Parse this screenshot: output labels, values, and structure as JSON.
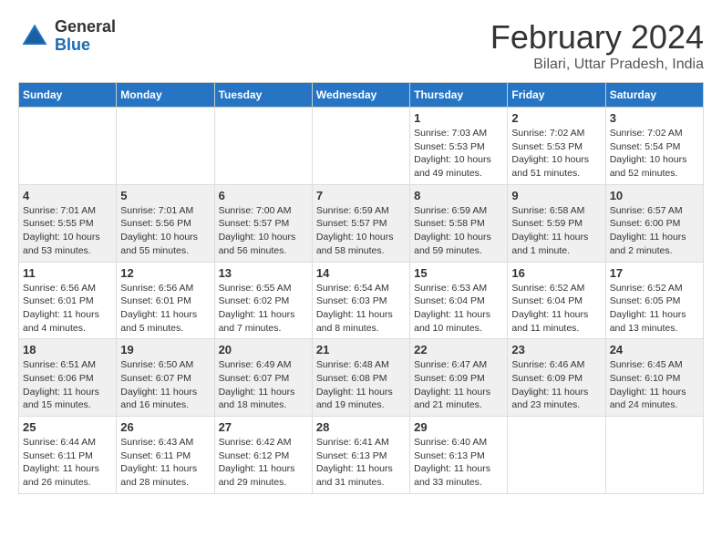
{
  "header": {
    "logo_general": "General",
    "logo_blue": "Blue",
    "title": "February 2024",
    "location": "Bilari, Uttar Pradesh, India"
  },
  "days_of_week": [
    "Sunday",
    "Monday",
    "Tuesday",
    "Wednesday",
    "Thursday",
    "Friday",
    "Saturday"
  ],
  "weeks": [
    [
      {
        "day": "",
        "info": ""
      },
      {
        "day": "",
        "info": ""
      },
      {
        "day": "",
        "info": ""
      },
      {
        "day": "",
        "info": ""
      },
      {
        "day": "1",
        "info": "Sunrise: 7:03 AM\nSunset: 5:53 PM\nDaylight: 10 hours\nand 49 minutes."
      },
      {
        "day": "2",
        "info": "Sunrise: 7:02 AM\nSunset: 5:53 PM\nDaylight: 10 hours\nand 51 minutes."
      },
      {
        "day": "3",
        "info": "Sunrise: 7:02 AM\nSunset: 5:54 PM\nDaylight: 10 hours\nand 52 minutes."
      }
    ],
    [
      {
        "day": "4",
        "info": "Sunrise: 7:01 AM\nSunset: 5:55 PM\nDaylight: 10 hours\nand 53 minutes."
      },
      {
        "day": "5",
        "info": "Sunrise: 7:01 AM\nSunset: 5:56 PM\nDaylight: 10 hours\nand 55 minutes."
      },
      {
        "day": "6",
        "info": "Sunrise: 7:00 AM\nSunset: 5:57 PM\nDaylight: 10 hours\nand 56 minutes."
      },
      {
        "day": "7",
        "info": "Sunrise: 6:59 AM\nSunset: 5:57 PM\nDaylight: 10 hours\nand 58 minutes."
      },
      {
        "day": "8",
        "info": "Sunrise: 6:59 AM\nSunset: 5:58 PM\nDaylight: 10 hours\nand 59 minutes."
      },
      {
        "day": "9",
        "info": "Sunrise: 6:58 AM\nSunset: 5:59 PM\nDaylight: 11 hours\nand 1 minute."
      },
      {
        "day": "10",
        "info": "Sunrise: 6:57 AM\nSunset: 6:00 PM\nDaylight: 11 hours\nand 2 minutes."
      }
    ],
    [
      {
        "day": "11",
        "info": "Sunrise: 6:56 AM\nSunset: 6:01 PM\nDaylight: 11 hours\nand 4 minutes."
      },
      {
        "day": "12",
        "info": "Sunrise: 6:56 AM\nSunset: 6:01 PM\nDaylight: 11 hours\nand 5 minutes."
      },
      {
        "day": "13",
        "info": "Sunrise: 6:55 AM\nSunset: 6:02 PM\nDaylight: 11 hours\nand 7 minutes."
      },
      {
        "day": "14",
        "info": "Sunrise: 6:54 AM\nSunset: 6:03 PM\nDaylight: 11 hours\nand 8 minutes."
      },
      {
        "day": "15",
        "info": "Sunrise: 6:53 AM\nSunset: 6:04 PM\nDaylight: 11 hours\nand 10 minutes."
      },
      {
        "day": "16",
        "info": "Sunrise: 6:52 AM\nSunset: 6:04 PM\nDaylight: 11 hours\nand 11 minutes."
      },
      {
        "day": "17",
        "info": "Sunrise: 6:52 AM\nSunset: 6:05 PM\nDaylight: 11 hours\nand 13 minutes."
      }
    ],
    [
      {
        "day": "18",
        "info": "Sunrise: 6:51 AM\nSunset: 6:06 PM\nDaylight: 11 hours\nand 15 minutes."
      },
      {
        "day": "19",
        "info": "Sunrise: 6:50 AM\nSunset: 6:07 PM\nDaylight: 11 hours\nand 16 minutes."
      },
      {
        "day": "20",
        "info": "Sunrise: 6:49 AM\nSunset: 6:07 PM\nDaylight: 11 hours\nand 18 minutes."
      },
      {
        "day": "21",
        "info": "Sunrise: 6:48 AM\nSunset: 6:08 PM\nDaylight: 11 hours\nand 19 minutes."
      },
      {
        "day": "22",
        "info": "Sunrise: 6:47 AM\nSunset: 6:09 PM\nDaylight: 11 hours\nand 21 minutes."
      },
      {
        "day": "23",
        "info": "Sunrise: 6:46 AM\nSunset: 6:09 PM\nDaylight: 11 hours\nand 23 minutes."
      },
      {
        "day": "24",
        "info": "Sunrise: 6:45 AM\nSunset: 6:10 PM\nDaylight: 11 hours\nand 24 minutes."
      }
    ],
    [
      {
        "day": "25",
        "info": "Sunrise: 6:44 AM\nSunset: 6:11 PM\nDaylight: 11 hours\nand 26 minutes."
      },
      {
        "day": "26",
        "info": "Sunrise: 6:43 AM\nSunset: 6:11 PM\nDaylight: 11 hours\nand 28 minutes."
      },
      {
        "day": "27",
        "info": "Sunrise: 6:42 AM\nSunset: 6:12 PM\nDaylight: 11 hours\nand 29 minutes."
      },
      {
        "day": "28",
        "info": "Sunrise: 6:41 AM\nSunset: 6:13 PM\nDaylight: 11 hours\nand 31 minutes."
      },
      {
        "day": "29",
        "info": "Sunrise: 6:40 AM\nSunset: 6:13 PM\nDaylight: 11 hours\nand 33 minutes."
      },
      {
        "day": "",
        "info": ""
      },
      {
        "day": "",
        "info": ""
      }
    ]
  ]
}
